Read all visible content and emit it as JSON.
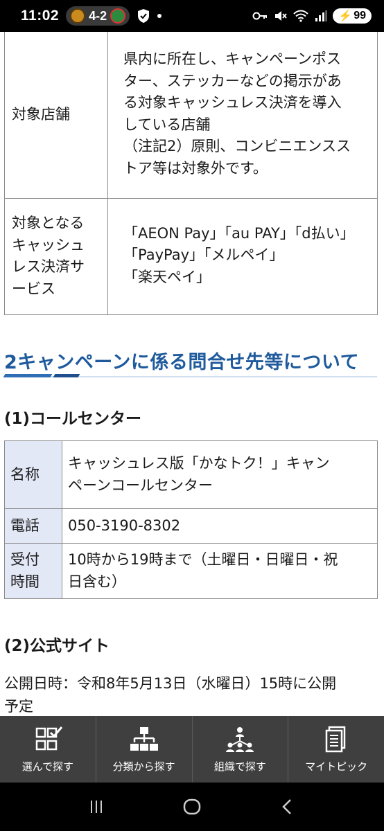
{
  "status_bar": {
    "time": "11:02",
    "score": "4-2",
    "battery": "99"
  },
  "table1": {
    "rows": [
      {
        "label": "対象店舗",
        "lines": [
          "県内に所在し、キャンペーンポス",
          "ター、ステッカーなどの掲示があ",
          "る対象キャッシュレス決済を導入",
          "している店舗",
          "（注記2）原則、コンビニエンスス",
          "トア等は対象外です。"
        ]
      },
      {
        "label_lines": [
          "対象となる",
          "キャッシュ",
          "レス決済サ",
          "ービス"
        ],
        "lines": [
          "「AEON Pay」「au PAY」「d払い」",
          "「PayPay」「メルペイ」",
          "「楽天ペイ」"
        ]
      }
    ]
  },
  "section2": {
    "heading": "2キャンペーンに係る問合せ先等について",
    "call_center": {
      "heading": "(1)コールセンター",
      "rows": [
        {
          "label": "名称",
          "lines": [
            "キャッシュレス版「かなトク！」キャン",
            "ペーンコールセンター"
          ]
        },
        {
          "label": "電話",
          "lines": [
            "050-3190-8302"
          ]
        },
        {
          "label_lines": [
            "受付",
            "時間"
          ],
          "lines": [
            "10時から19時まで（土曜日・日曜日・祝",
            "日含む）"
          ]
        }
      ]
    },
    "official_site": {
      "heading": "(2)公式サイト",
      "text_lines": [
        "公開日時：令和8年5月13日（水曜日）15時に公開",
        "予定"
      ]
    }
  },
  "bottom_nav": {
    "items": [
      {
        "label": "選んで探す",
        "icon": "checklist-icon"
      },
      {
        "label": "分類から探す",
        "icon": "hierarchy-icon"
      },
      {
        "label": "組織で探す",
        "icon": "people-network-icon"
      },
      {
        "label": "マイトピック",
        "icon": "documents-icon"
      }
    ]
  },
  "colors": {
    "heading_blue": "#1e5a9c",
    "label_bg": "#e3e8f7",
    "nav_bg": "#3f3f3f"
  }
}
